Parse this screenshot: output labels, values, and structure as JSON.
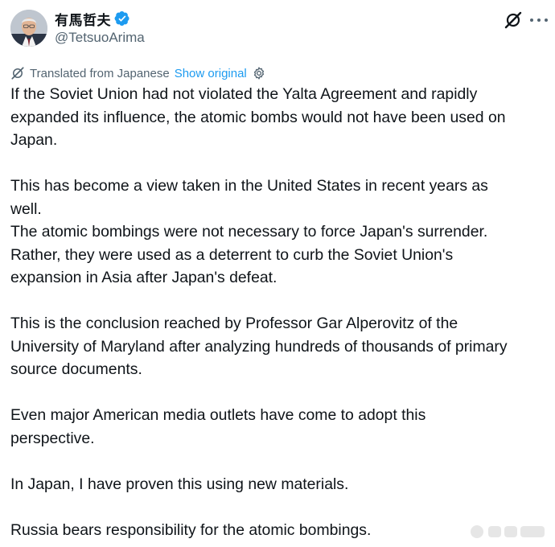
{
  "author": {
    "display_name": "有馬哲夫",
    "handle": "@TetsuoArima",
    "verified": true,
    "verified_color": "#1d9bf0"
  },
  "header_actions": {
    "grok_icon": "grok-icon",
    "more_icon": "more-horizontal-icon"
  },
  "translation": {
    "label": "Translated from Japanese",
    "show_original": "Show original",
    "settings_icon": "gear-icon",
    "link_color": "#1d9bf0"
  },
  "tweet": {
    "paragraphs": [
      "If the Soviet Union had not violated the Yalta Agreement and rapidly\nexpanded its influence, the atomic bombs would not have been used on\nJapan.",
      "This has become a view taken in the United States in recent years as\nwell.\nThe atomic bombings were not necessary to force Japan's surrender.\nRather, they were used as a deterrent to curb the Soviet Union's\nexpansion in Asia after Japan's defeat.",
      "This is the conclusion reached by Professor Gar Alperovitz of the\nUniversity of Maryland after analyzing hundreds of thousands of primary\nsource documents.",
      "Even major American media outlets have come to adopt this\nperspective.",
      "In Japan, I have proven this using new materials.",
      "Russia bears responsibility for the atomic bombings."
    ]
  }
}
